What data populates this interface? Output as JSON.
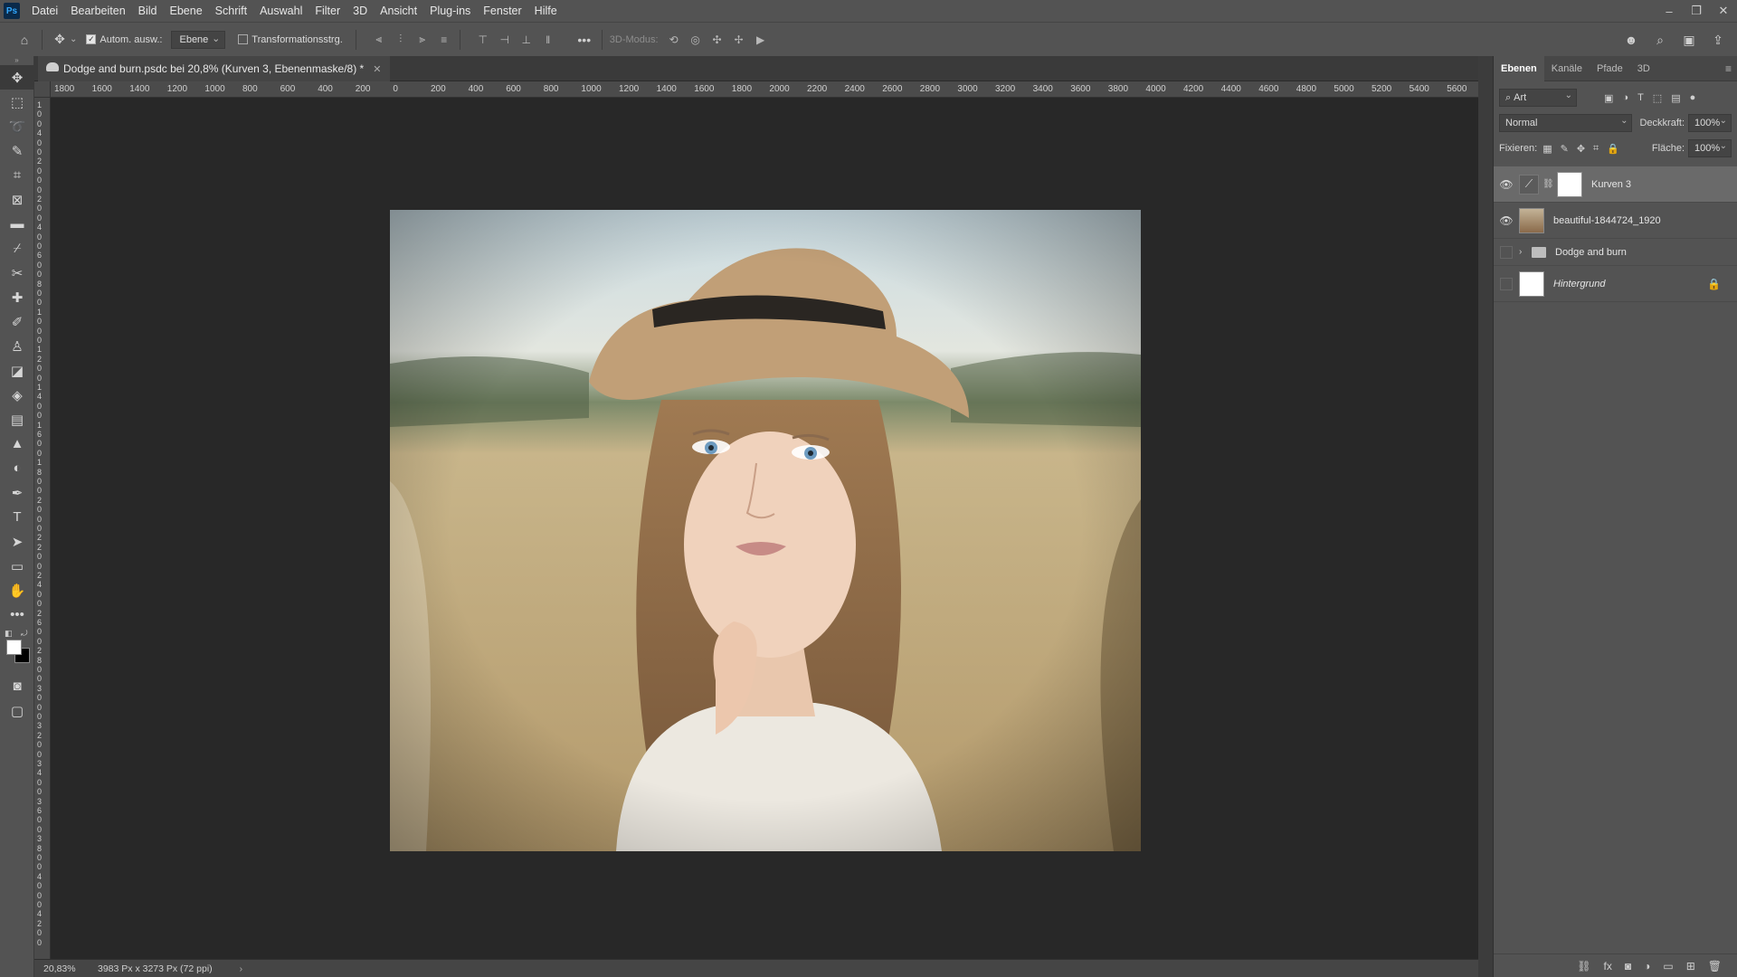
{
  "menubar": {
    "logo": "Ps",
    "items": [
      "Datei",
      "Bearbeiten",
      "Bild",
      "Ebene",
      "Schrift",
      "Auswahl",
      "Filter",
      "3D",
      "Ansicht",
      "Plug-ins",
      "Fenster",
      "Hilfe"
    ]
  },
  "options": {
    "auto_select_label": "Autom. ausw.:",
    "auto_select_target": "Ebene",
    "transform_label": "Transformationsstrg.",
    "mode3d_label": "3D-Modus:"
  },
  "document": {
    "tab_title": "Dodge and burn.psdc bei 20,8% (Kurven 3, Ebenenmaske/8) *"
  },
  "ruler": {
    "h_ticks": [
      "1800",
      "1600",
      "1400",
      "1200",
      "1000",
      "800",
      "600",
      "400",
      "200",
      "0",
      "200",
      "400",
      "600",
      "800",
      "1000",
      "1200",
      "1400",
      "1600",
      "1800",
      "2000",
      "2200",
      "2400",
      "2600",
      "2800",
      "3000",
      "3200",
      "3400",
      "3600",
      "3800",
      "4000",
      "4200",
      "4400",
      "4600",
      "4800",
      "5000",
      "5200",
      "5400",
      "5600"
    ]
  },
  "status": {
    "zoom": "20,83%",
    "doc_info": "3983 Px x 3273 Px (72 ppi)"
  },
  "layers_panel": {
    "tabs": [
      "Ebenen",
      "Kanäle",
      "Pfade",
      "3D"
    ],
    "filter_kind": "Art",
    "blend_mode": "Normal",
    "opacity_label": "Deckkraft:",
    "opacity_value": "100%",
    "lock_label": "Fixieren:",
    "fill_label": "Fläche:",
    "fill_value": "100%",
    "layers": [
      {
        "name": "Kurven 3",
        "visible": true,
        "selected": true
      },
      {
        "name": "beautiful-1844724_1920",
        "visible": true
      },
      {
        "name": "Dodge and burn",
        "visible": false,
        "group": true
      },
      {
        "name": "Hintergrund",
        "visible": false,
        "locked": true
      }
    ]
  }
}
